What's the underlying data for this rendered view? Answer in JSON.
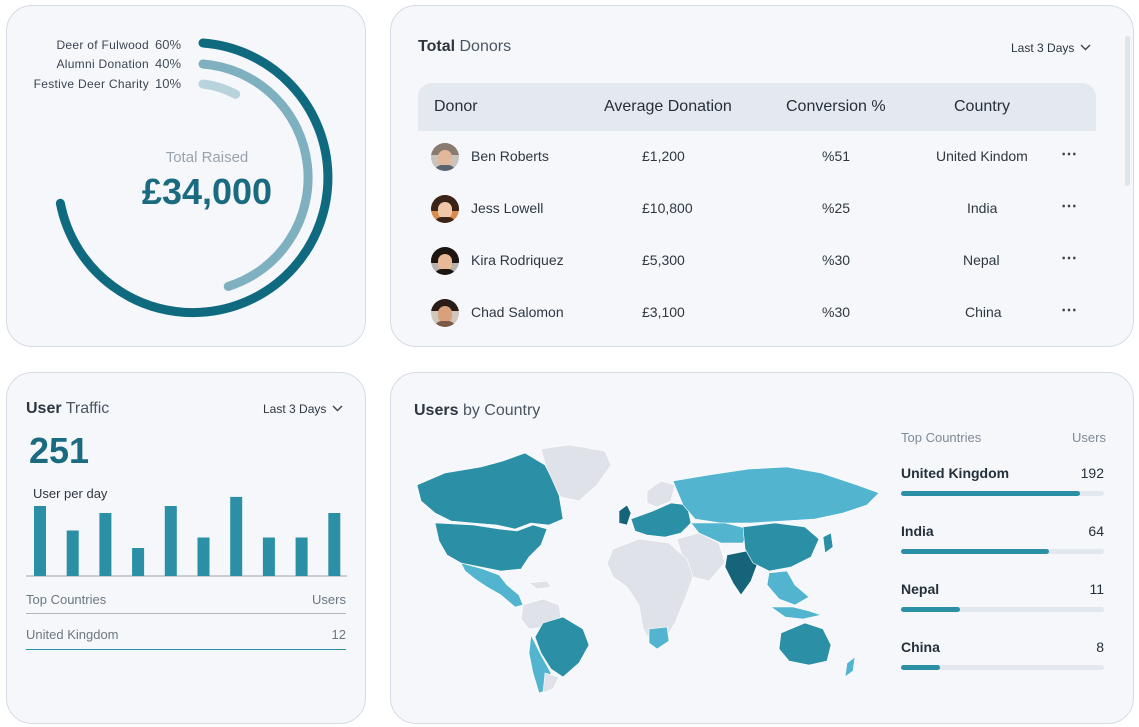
{
  "raised": {
    "legend": [
      {
        "name": "Deer of Fulwood",
        "pct": "60%",
        "fraction": 0.6,
        "color": "#0f6a7f"
      },
      {
        "name": "Alumni Donation",
        "pct": "40%",
        "fraction": 0.4,
        "color": "#7fb0c0"
      },
      {
        "name": "Festive Deer Charity",
        "pct": "10%",
        "fraction": 0.1,
        "color": "#b9d3dc"
      }
    ],
    "label": "Total Raised",
    "amount": "£34,000"
  },
  "donors": {
    "title_bold": "Total",
    "title_rest": "Donors",
    "range": "Last 3 Days",
    "columns": [
      "Donor",
      "Average Donation",
      "Conversion %",
      "Country"
    ],
    "rows": [
      {
        "name": "Ben Roberts",
        "avg": "£1,200",
        "conv": "%51",
        "country": "United Kindom"
      },
      {
        "name": "Jess Lowell",
        "avg": "£10,800",
        "conv": "%25",
        "country": "India"
      },
      {
        "name": "Kira Rodriquez",
        "avg": "£5,300",
        "conv": "%30",
        "country": "Nepal"
      },
      {
        "name": "Chad Salomon",
        "avg": "£3,100",
        "conv": "%30",
        "country": "China"
      }
    ],
    "more_icon": "⋯"
  },
  "traffic": {
    "title_bold": "User",
    "title_rest": "Traffic",
    "range": "Last 3 Days",
    "count": "251",
    "subtitle": "User per day",
    "chart_data": {
      "type": "bar",
      "values": [
        10,
        6.5,
        9,
        4,
        10,
        5.5,
        11.3,
        5.5,
        5.5,
        9
      ],
      "ylim": [
        0,
        12
      ],
      "color": "#2b8fa6"
    },
    "footer_header": {
      "left": "Top Countries",
      "right": "Users"
    },
    "footer_row": {
      "left": "United Kingdom",
      "right": "12"
    }
  },
  "country": {
    "title_bold": "Users",
    "title_rest": "by Country",
    "head": {
      "left": "Top Countries",
      "right": "Users"
    },
    "items": [
      {
        "name": "United Kingdom",
        "value": "192",
        "fraction": 0.88
      },
      {
        "name": "India",
        "value": "64",
        "fraction": 0.73
      },
      {
        "name": "Nepal",
        "value": "11",
        "fraction": 0.29
      },
      {
        "name": "China",
        "value": "8",
        "fraction": 0.19
      }
    ],
    "map_colors": {
      "dark": "#2b8fa6",
      "mid": "#52b4ce",
      "light": "#dfe2e8",
      "darkest": "#15647a"
    }
  }
}
